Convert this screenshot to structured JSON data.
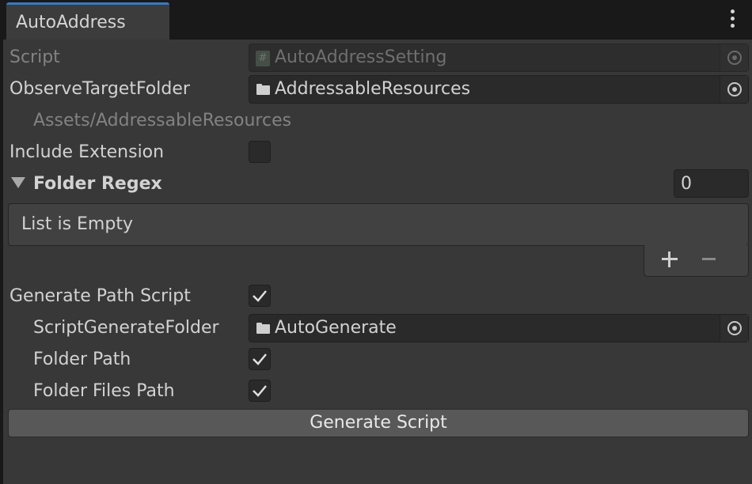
{
  "window": {
    "tab_title": "AutoAddress"
  },
  "icons": {
    "more": "kebab-menu-icon",
    "folder": "folder-icon",
    "script": "csharp-script-icon",
    "picker": "object-picker-icon",
    "check": "checkmark-icon",
    "foldout": "triangle-down-icon"
  },
  "colors": {
    "background": "#383838",
    "field": "#2a2a2a",
    "tab_accent": "#3a79bb",
    "button": "#585858"
  },
  "fields": {
    "script": {
      "label": "Script",
      "value": "AutoAddressSetting"
    },
    "observe_target_folder": {
      "label": "ObserveTargetFolder",
      "value": "AddressableResources",
      "path_hint": "Assets/AddressableResources"
    },
    "include_extension": {
      "label": "Include Extension",
      "checked": false
    },
    "folder_regex": {
      "label": "Folder Regex",
      "count": "0",
      "empty_text": "List is Empty"
    },
    "generate_path_script": {
      "label": "Generate Path Script",
      "checked": true
    },
    "script_generate_folder": {
      "label": "ScriptGenerateFolder",
      "value": "AutoGenerate"
    },
    "folder_path": {
      "label": "Folder Path",
      "checked": true
    },
    "folder_files_path": {
      "label": "Folder Files Path",
      "checked": true
    }
  },
  "actions": {
    "generate_script": "Generate Script"
  }
}
